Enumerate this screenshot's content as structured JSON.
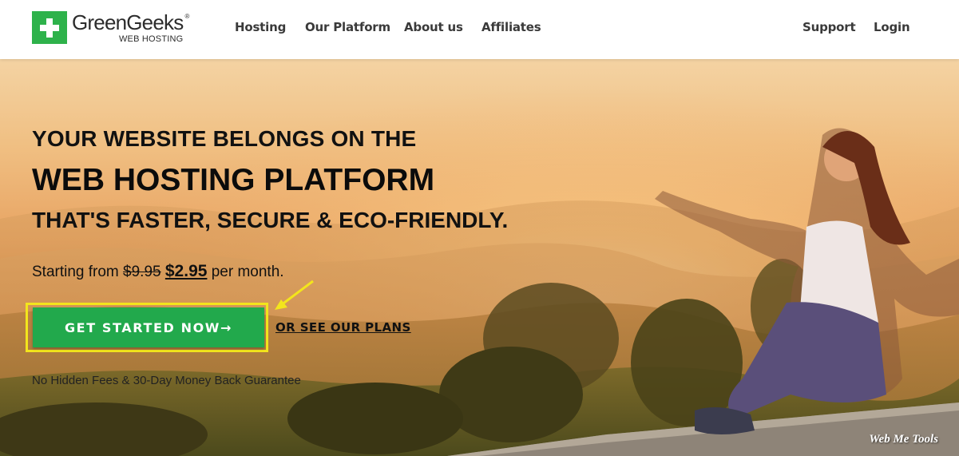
{
  "logo": {
    "name": "GreenGeeks",
    "registered": "®",
    "subtitle": "WEB HOSTING",
    "color": "#2eb24b"
  },
  "nav": {
    "left": [
      "Hosting",
      "Our Platform",
      "About us",
      "Affiliates"
    ],
    "right": [
      "Support",
      "Login"
    ]
  },
  "hero": {
    "line1": "YOUR WEBSITE BELONGS ON THE",
    "line2": "WEB HOSTING PLATFORM",
    "line3": "THAT'S FASTER, SECURE & ECO-FRIENDLY.",
    "price_prefix": "Starting from",
    "old_price": "$9.95",
    "new_price": "$2.95",
    "price_suffix": "per month.",
    "cta_label": "GET STARTED NOW",
    "cta_arrow": "→",
    "cta_color": "#22a94c",
    "highlight_color": "#f3e51c",
    "plans_link": "OR SEE OUR PLANS",
    "guarantee": "No Hidden Fees & 30-Day Money Back Guarantee"
  },
  "watermark": "Web Me Tools"
}
